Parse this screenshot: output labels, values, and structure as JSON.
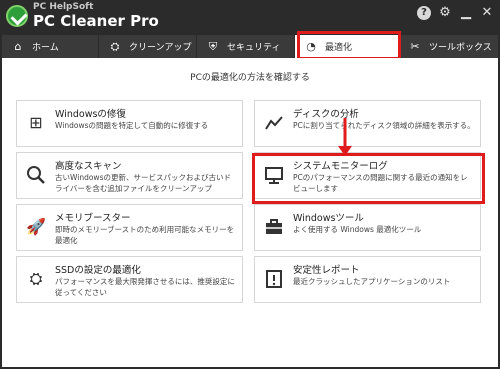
{
  "app": {
    "brand_top": "PC HelpSoft",
    "brand_main": "PC Cleaner Pro"
  },
  "titlebar_icons": [
    "help-icon",
    "gear-icon",
    "minimize-icon",
    "close-icon"
  ],
  "tabs": [
    {
      "label": "ホーム",
      "icon": "home-icon"
    },
    {
      "label": "クリーンアップ",
      "icon": "broom-icon"
    },
    {
      "label": "セキュリティ",
      "icon": "shield-icon"
    },
    {
      "label": "最適化",
      "icon": "speedometer-icon",
      "active": true
    },
    {
      "label": "ツールボックス",
      "icon": "tools-icon"
    }
  ],
  "main": {
    "subtitle": "PCの最適化の方法を確認する",
    "cards": [
      {
        "title": "Windowsの修復",
        "desc": "Windowsの問題を特定して自動的に修復する",
        "icon": "windows-repair-icon"
      },
      {
        "title": "ディスクの分析",
        "desc": "PCに割り当てられたディスク領域の詳細を表示する。",
        "icon": "chart-line-icon"
      },
      {
        "title": "高度なスキャン",
        "desc": "古いWindowsの更新、サービスパックおよび古いドライバーを含む追加ファイルをクリーンアップ",
        "icon": "scan-icon"
      },
      {
        "title": "システムモニターログ",
        "desc": "PCのパフォーマンスの問題に関する最近の通知をレビューします",
        "icon": "monitor-icon"
      },
      {
        "title": "メモリブースター",
        "desc": "即時のメモリーブーストのため利用可能なメモリーを最適化",
        "icon": "rocket-icon"
      },
      {
        "title": "Windowsツール",
        "desc": "よく使用する Windows 最適化ツール",
        "icon": "toolbox-icon"
      },
      {
        "title": "SSDの設定の最適化",
        "desc": "パフォーマンスを最大限発揮させるには、推奨設定に従ってください",
        "icon": "ssd-settings-icon"
      },
      {
        "title": "安定性レポート",
        "desc": "最近クラッシュしたアプリケーションのリスト",
        "icon": "report-icon"
      }
    ]
  },
  "colors": {
    "titlebar": "#2b2b2b",
    "tab_inactive": "#3a3a3a",
    "highlight": "#e01b1b",
    "logo": "#2e9e3a"
  }
}
